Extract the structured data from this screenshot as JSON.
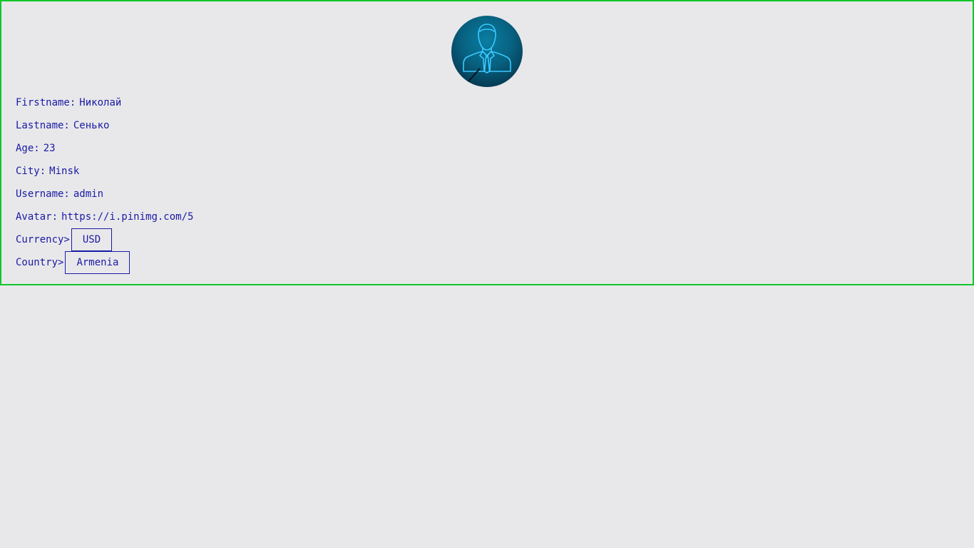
{
  "profile": {
    "avatar_icon": "user-silhouette-icon",
    "fields": {
      "firstname": {
        "label": "Firstname:",
        "value": "Николай"
      },
      "lastname": {
        "label": "Lastname:",
        "value": "Сенько"
      },
      "age": {
        "label": "Age:",
        "value": "23"
      },
      "city": {
        "label": "City:",
        "value": "Minsk"
      },
      "username": {
        "label": "Username:",
        "value": "admin"
      },
      "avatar": {
        "label": "Avatar:",
        "value": "https://i.pinimg.com/5"
      }
    },
    "currency": {
      "label": "Currency>",
      "value": "USD"
    },
    "country": {
      "label": "Country>",
      "value": "Armenia"
    }
  },
  "colors": {
    "background": "#e8e8ea",
    "border": "#11c62a",
    "text": "#1a1aa6"
  }
}
